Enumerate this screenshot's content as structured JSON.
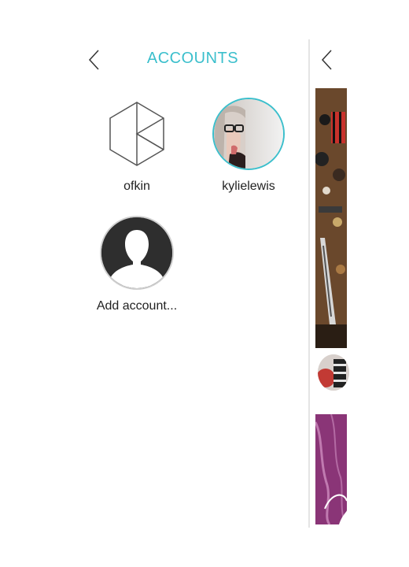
{
  "header": {
    "title": "ACCOUNTS",
    "back_icon": "chevron-left-icon"
  },
  "accounts": [
    {
      "username": "ofkin",
      "icon": "ofkin-logo-icon"
    },
    {
      "username": "kylielewis",
      "icon": "profile-photo"
    },
    {
      "username": "Add account...",
      "icon": "person-silhouette-icon"
    }
  ],
  "right_panel": {
    "back_icon": "chevron-left-icon"
  },
  "colors": {
    "accent": "#3bbfcc",
    "text": "#222222",
    "divider": "#e4e4e4",
    "placeholder_avatar_bg": "#2e2e2e"
  }
}
